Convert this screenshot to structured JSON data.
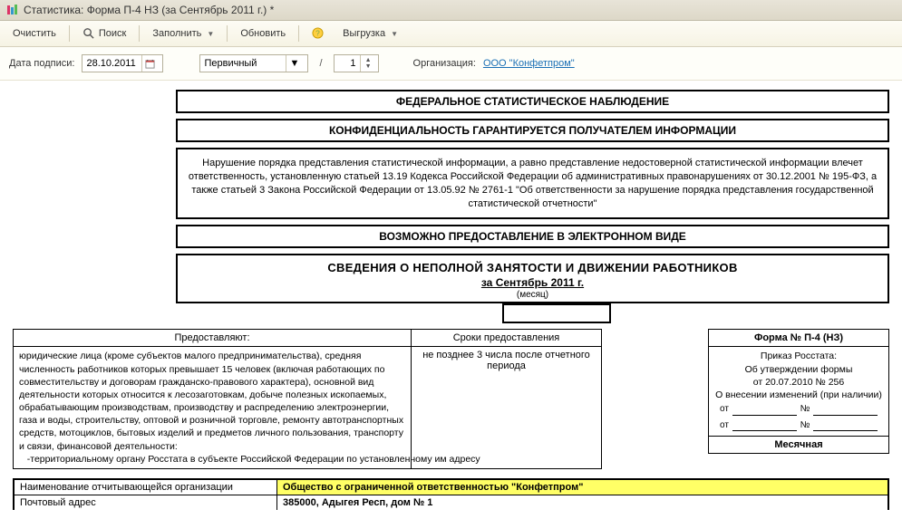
{
  "window": {
    "title": "Статистика: Форма П-4 НЗ (за Сентябрь 2011 г.) *"
  },
  "toolbar": {
    "clear": "Очистить",
    "search": "Поиск",
    "fill": "Заполнить",
    "refresh": "Обновить",
    "export": "Выгрузка"
  },
  "params": {
    "date_label": "Дата подписи:",
    "date_value": "28.10.2011",
    "kind_value": "Первичный",
    "spin_value": "1",
    "org_label": "Организация:",
    "org_value": "ООО \"Конфетпром\""
  },
  "doc": {
    "box1": "ФЕДЕРАЛЬНОЕ СТАТИСТИЧЕСКОЕ НАБЛЮДЕНИЕ",
    "box2": "КОНФИДЕНЦИАЛЬНОСТЬ ГАРАНТИРУЕТСЯ ПОЛУЧАТЕЛЕМ ИНФОРМАЦИИ",
    "box3": "Нарушение порядка представления статистической информации, а равно представление недостоверной статистической информации влечет ответственность, установленную статьей 13.19 Кодекса Российской Федерации об административных правонарушениях от 30.12.2001 № 195-ФЗ, а также статьей 3 Закона Российской Федерации от 13.05.92 № 2761-1 \"Об ответственности за нарушение порядка представления государственной статистической отчетности\"",
    "box4": "ВОЗМОЖНО ПРЕДОСТАВЛЕНИЕ В ЭЛЕКТРОННОМ ВИДЕ",
    "title_l1": "СВЕДЕНИЯ О НЕПОЛНОЙ ЗАНЯТОСТИ И ДВИЖЕНИИ РАБОТНИКОВ",
    "title_l2": "за Сентябрь 2011 г.",
    "title_l3": "(месяц)",
    "left_header": "Предоставляют:",
    "mid_header": "Сроки предоставления",
    "left_body": "юридические лица (кроме субъектов малого предпринимательства), средняя численность работников которых превышает 15 человек (включая работающих по совместительству и договорам гражданско-правового характера), основной вид деятельности которых относится к лесозаготовкам, добыче полезных ископаемых, обрабатывающим производствам, производству и распределению электроэнергии, газа и воды, строительству, оптовой и розничной торговле, ремонту автотранспортных средств, мотоциклов, бытовых изделий и предметов личного пользования, транспорту и связи, финансовой деятельности:",
    "left_body_sub": "   -территориальному органу Росстата в субъекте Российской Федерации по установленному им адресу",
    "mid_body": "не позднее 3 числа после отчетного периода",
    "form_no": "Форма № П-4 (НЗ)",
    "order1": "Приказ Росстата:",
    "order2": "Об утверждении формы",
    "order3": "от 20.07.2010 № 256",
    "order4": "О внесении изменений (при наличии)",
    "ot": "от",
    "no": "№",
    "period": "Месячная",
    "footer_label1": "Наименование отчитывающейся организации",
    "footer_val1": "Общество с ограниченной ответственностью \"Конфетпром\"",
    "footer_label2": "Почтовый адрес",
    "footer_val2": "385000, Адыгея Респ, дом № 1"
  }
}
